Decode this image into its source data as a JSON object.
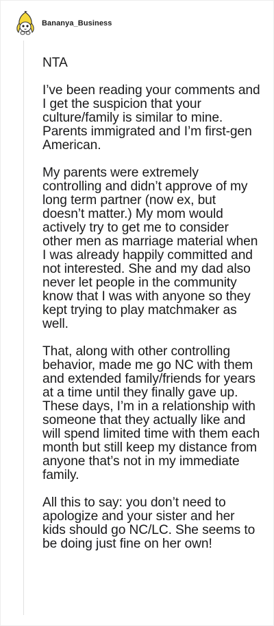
{
  "comment": {
    "author": "Bananya_Business",
    "avatar_icon": "bananya-cat-avatar-icon",
    "paragraphs": [
      "NTA",
      "I’ve been reading your comments and I get the suspicion that your culture/family is similar to mine. Parents immigrated and I’m first-gen American.",
      "My parents were extremely controlling and didn’t approve of my long term partner (now ex, but doesn’t matter.) My mom would actively try to get me to consider other men as marriage material when I was already happily committed and not interested. She and my dad also never let people in the community know that I was with anyone so they kept trying to play matchmaker as well.",
      "That, along with other controlling behavior, made me go NC with them and extended family/friends for years at a time until they finally gave up. These days, I’m in a relationship with someone that they actually like and will spend limited time with them each month but still keep my distance from anyone that’s not in my immediate family.",
      "All this to say: you don’t need to apologize and your sister and her kids should go NC/LC. She seems to be doing just fine on her own!"
    ]
  },
  "colors": {
    "background": "#ffffff",
    "text": "#1a1a1b",
    "thread_line": "#e0e0e0",
    "banana_yellow": "#f5d83a"
  }
}
